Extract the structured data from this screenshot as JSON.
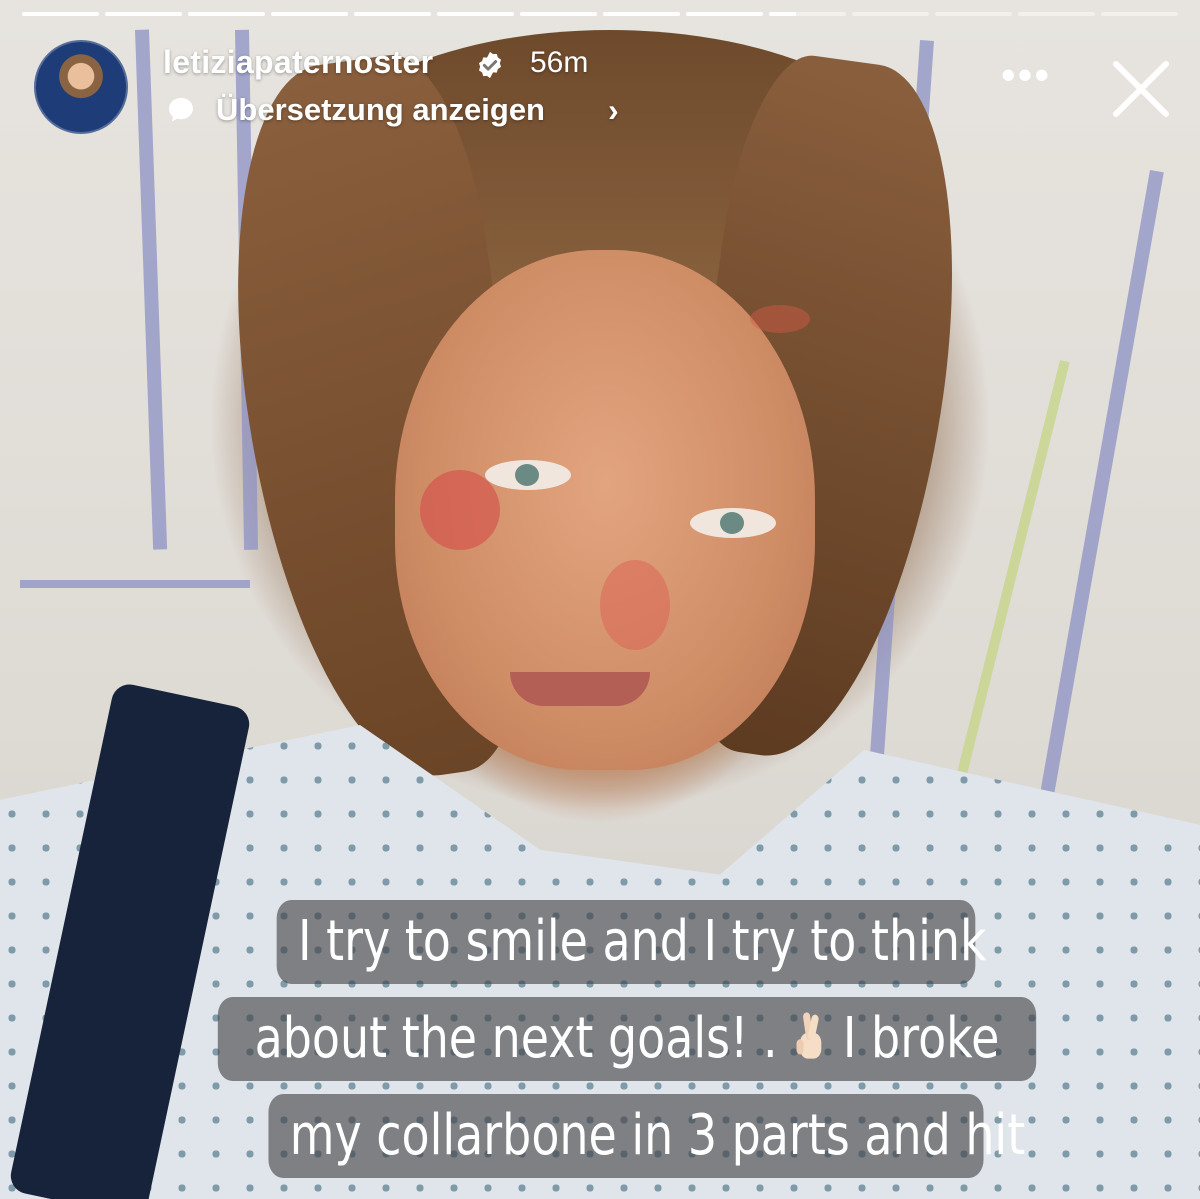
{
  "story": {
    "segments_total": 14,
    "current_segment": 10,
    "current_progress": 0.35,
    "username": "letiziapaternoster",
    "verified": true,
    "time_ago": "56m",
    "translate_label": "Übersetzung anzeigen",
    "chevron": "›",
    "more_label": "•••",
    "icons": {
      "verified": "verified-badge-icon",
      "translate": "speech-bubble-icon",
      "more": "more-dots-icon",
      "close": "close-icon"
    }
  },
  "caption": {
    "line1": "I try to smile and I try to think",
    "line2_a": "about the next goals! . ",
    "line2_emoji": "crossed-fingers-emoji",
    "line2_b": " I broke",
    "line3": "my collarbone in 3 parts and hit"
  },
  "colors": {
    "text": "#ffffff",
    "caption_bg": "rgba(66,66,70,0.62)"
  }
}
